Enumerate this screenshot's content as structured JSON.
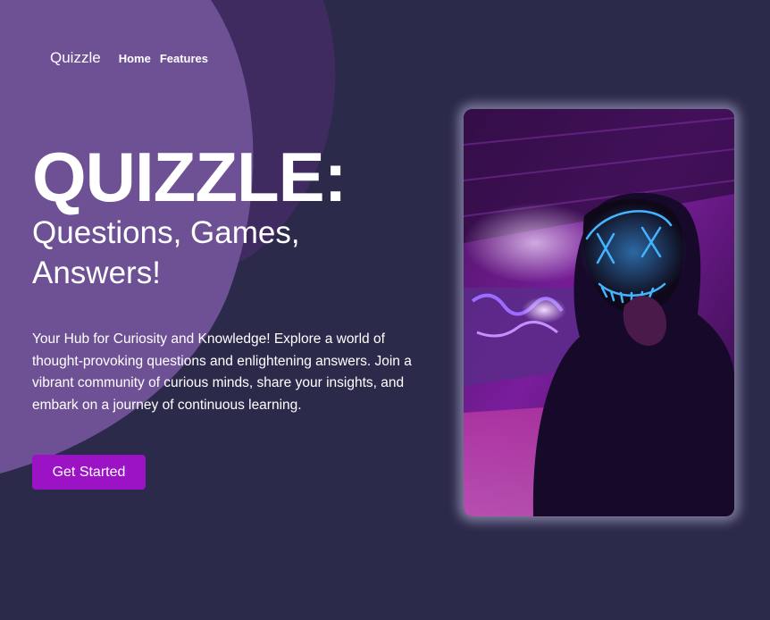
{
  "colors": {
    "background": "#2c2a4b",
    "blob_light": "#6e5195",
    "blob_dark": "#3f2b5f",
    "accent": "#9b13c4",
    "text": "#ffffff"
  },
  "nav": {
    "brand": "Quizzle",
    "links": [
      "Home",
      "Features"
    ]
  },
  "hero": {
    "title": "QUIZZLE:",
    "subtitle": "Questions, Games, Answers!",
    "description": "Your Hub for Curiosity and Knowledge! Explore a world of thought-provoking questions and enlightening answers. Join a vibrant community of curious minds, share your insights, and embark on a journey of continuous learning.",
    "cta_label": "Get Started"
  },
  "image": {
    "subject": "hooded-figure-neon-mask-photo"
  }
}
